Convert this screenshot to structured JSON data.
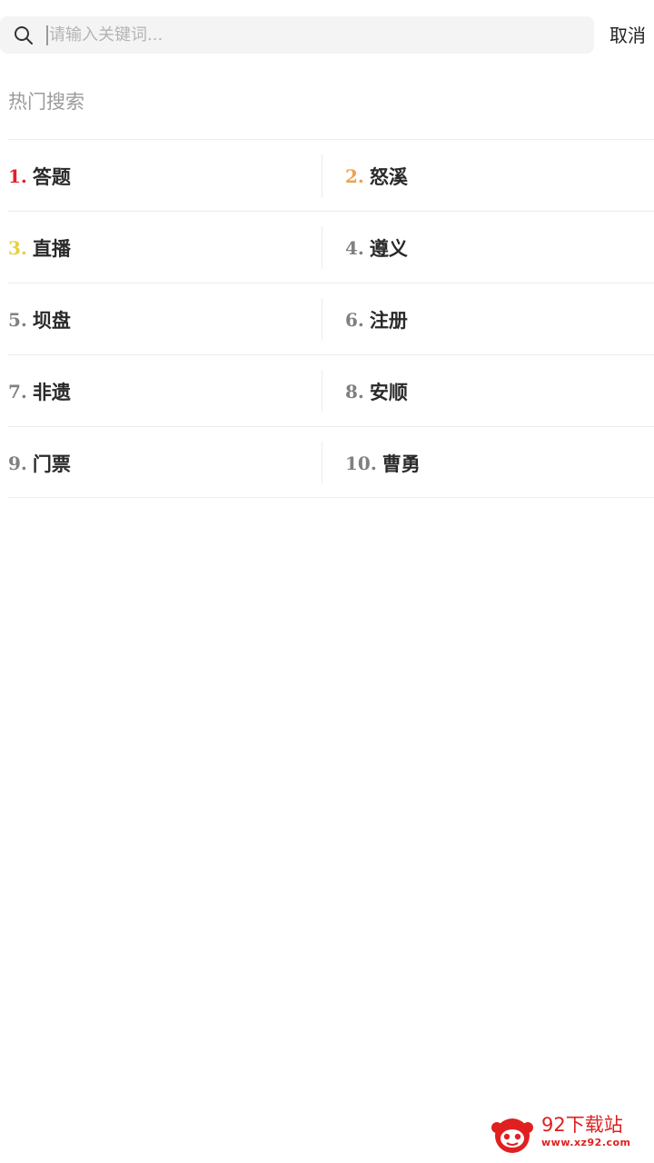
{
  "search": {
    "placeholder": "请输入关键词...",
    "value": "",
    "cancel_label": "取消"
  },
  "hot_search": {
    "title": "热门搜索",
    "items": [
      {
        "rank": "1.",
        "label": "答题",
        "rank_color": "#e0202a"
      },
      {
        "rank": "2.",
        "label": "怒溪",
        "rank_color": "#f0a050"
      },
      {
        "rank": "3.",
        "label": "直播",
        "rank_color": "#e6d040"
      },
      {
        "rank": "4.",
        "label": "遵义",
        "rank_color": "#808080"
      },
      {
        "rank": "5.",
        "label": "坝盘",
        "rank_color": "#808080"
      },
      {
        "rank": "6.",
        "label": "注册",
        "rank_color": "#808080"
      },
      {
        "rank": "7.",
        "label": "非遗",
        "rank_color": "#808080"
      },
      {
        "rank": "8.",
        "label": "安顺",
        "rank_color": "#808080"
      },
      {
        "rank": "9.",
        "label": "门票",
        "rank_color": "#808080"
      },
      {
        "rank": "10.",
        "label": "曹勇",
        "rank_color": "#808080"
      }
    ]
  },
  "watermark": {
    "title": "92下载站",
    "url": "www.xz92.com",
    "color": "#e02020"
  }
}
